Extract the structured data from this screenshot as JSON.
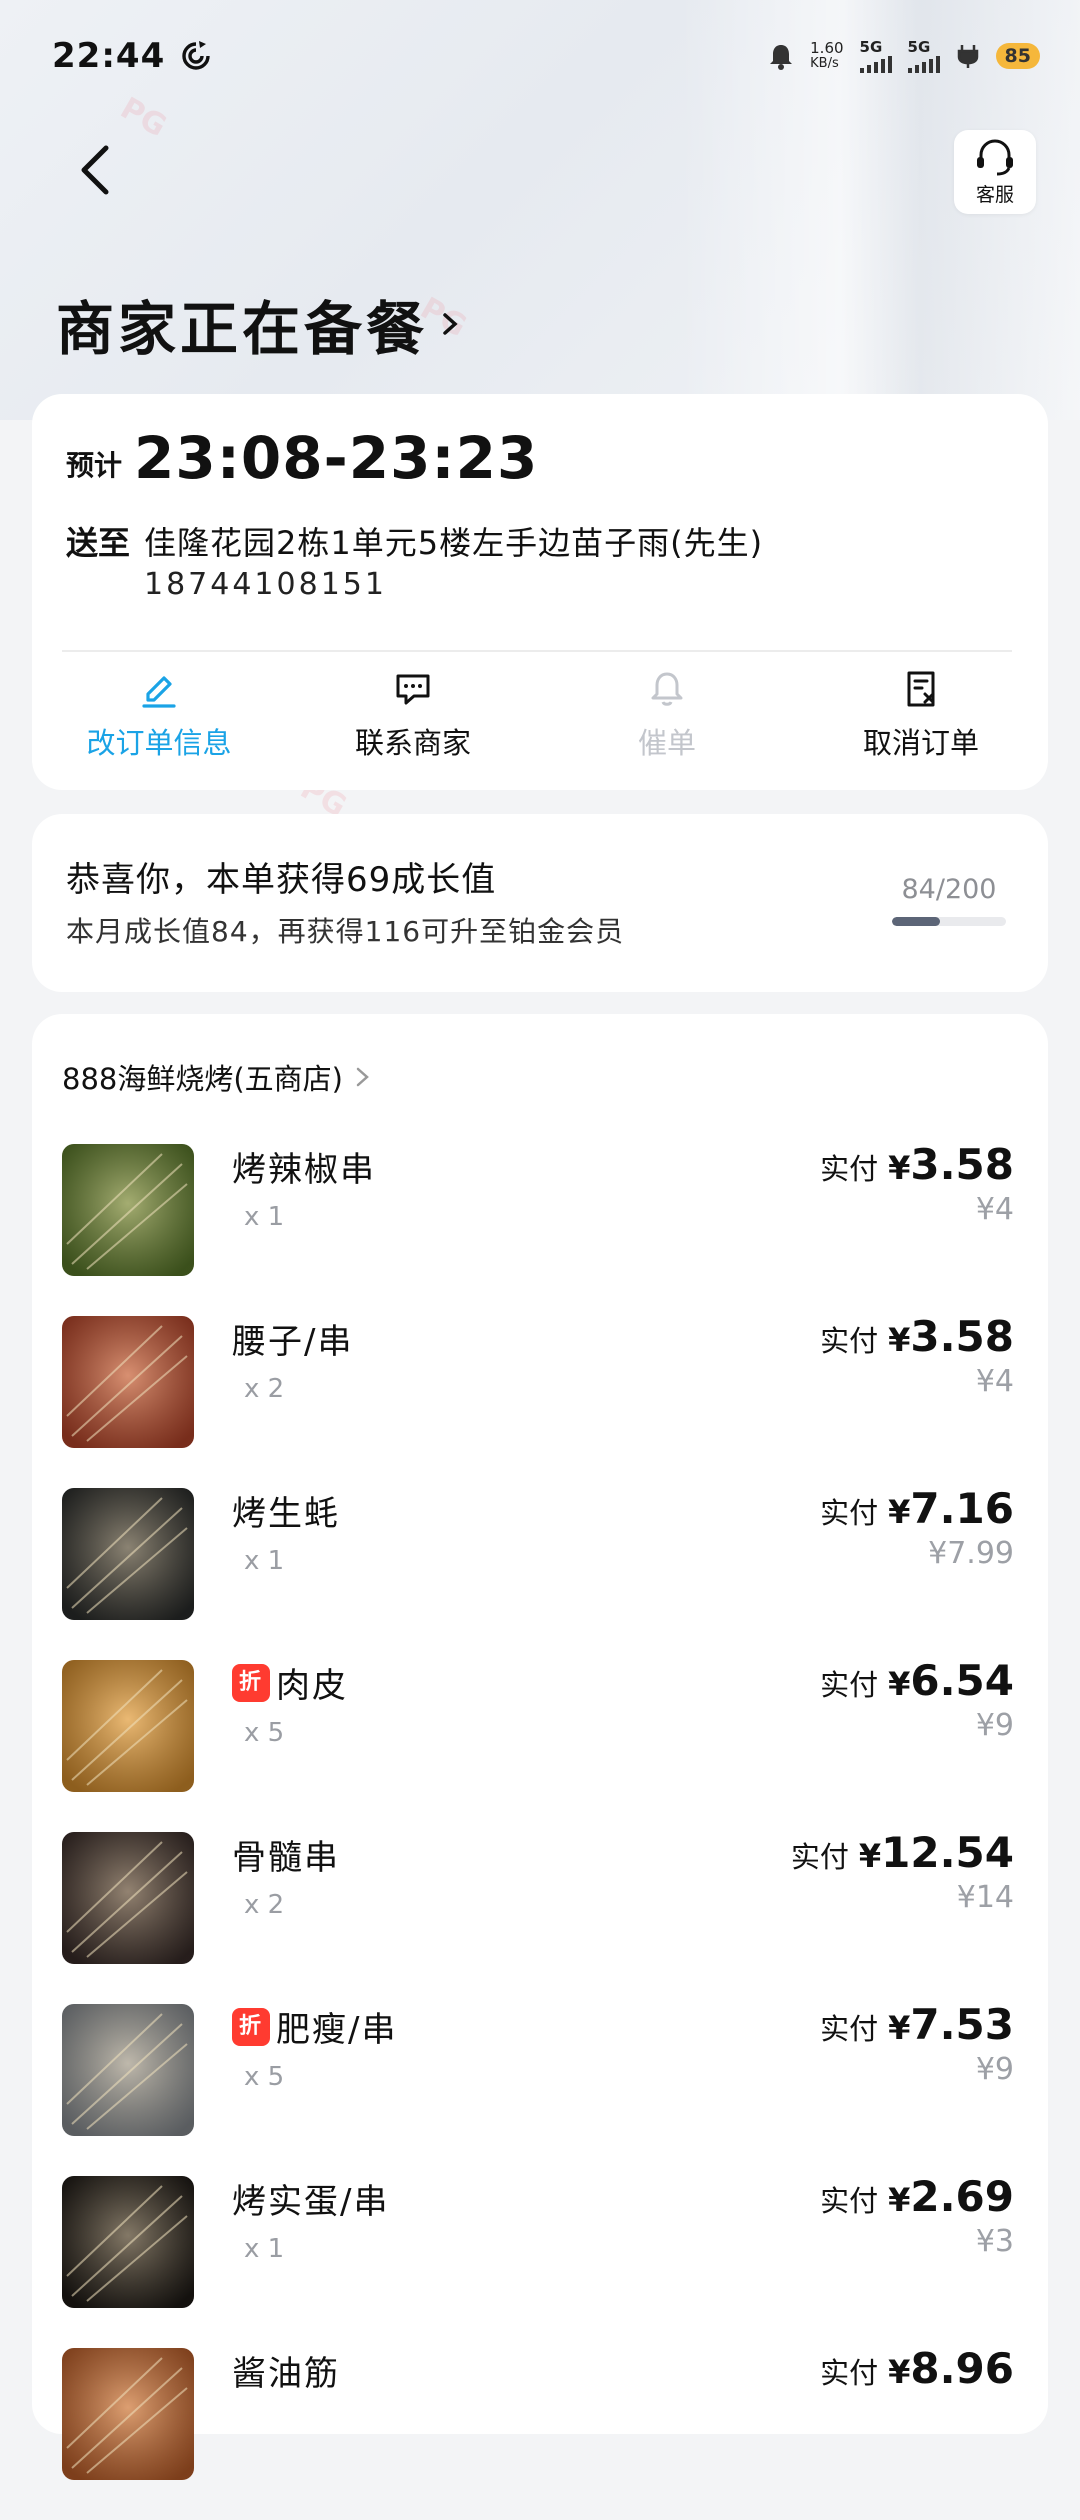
{
  "status_bar": {
    "time": "22:44",
    "net_speed": "1.60",
    "net_unit": "KB/s",
    "sim1": "5G",
    "sim2": "5G",
    "battery": "85"
  },
  "header": {
    "customer_service_label": "客服",
    "title": "商家正在备餐"
  },
  "delivery": {
    "eta_label": "预计",
    "eta_time": "23:08-23:23",
    "address_label": "送至",
    "address": "佳隆花园2栋1单元5楼左手边苗子雨(先生)",
    "phone": "18744108151"
  },
  "actions": [
    {
      "label": "改订单信息",
      "icon": "edit-icon",
      "state": "active"
    },
    {
      "label": "联系商家",
      "icon": "chat-icon",
      "state": "normal"
    },
    {
      "label": "催单",
      "icon": "bell-icon",
      "state": "disabled"
    },
    {
      "label": "取消订单",
      "icon": "cancel-doc-icon",
      "state": "normal"
    }
  ],
  "growth": {
    "headline": "恭喜你，本单获得69成长值",
    "detail": "本月成长值84，再获得116可升至铂金会员",
    "progress_text": "84/200",
    "progress_fraction": 0.42
  },
  "shop": {
    "name": "888海鲜烧烤(五商店)"
  },
  "items": [
    {
      "name": "烤辣椒串",
      "qty": "x 1",
      "paid_label": "实付",
      "currency": "¥",
      "price": "3.58",
      "original": "¥4",
      "discount_tag": "",
      "color": "#5a7a2a"
    },
    {
      "name": "腰子/串",
      "qty": "x 2",
      "paid_label": "实付",
      "currency": "¥",
      "price": "3.58",
      "original": "¥4",
      "discount_tag": "",
      "color": "#b8452a"
    },
    {
      "name": "烤生蚝",
      "qty": "x 1",
      "paid_label": "实付",
      "currency": "¥",
      "price": "7.16",
      "original": "¥7.99",
      "discount_tag": "",
      "color": "#2b2d2c"
    },
    {
      "name": "肉皮",
      "qty": "x 5",
      "paid_label": "实付",
      "currency": "¥",
      "price": "6.54",
      "original": "¥9",
      "discount_tag": "折",
      "color": "#d9902e"
    },
    {
      "name": "骨髓串",
      "qty": "x 2",
      "paid_label": "实付",
      "currency": "¥",
      "price": "12.54",
      "original": "¥14",
      "discount_tag": "",
      "color": "#3a2d2a"
    },
    {
      "name": "肥瘦/串",
      "qty": "x 5",
      "paid_label": "实付",
      "currency": "¥",
      "price": "7.53",
      "original": "¥9",
      "discount_tag": "折",
      "color": "#8a8f94"
    },
    {
      "name": "烤实蛋/串",
      "qty": "x 1",
      "paid_label": "实付",
      "currency": "¥",
      "price": "2.69",
      "original": "¥3",
      "discount_tag": "",
      "color": "#1e1a16"
    },
    {
      "name": "酱油筋",
      "qty": "",
      "paid_label": "实付",
      "currency": "¥",
      "price": "8.96",
      "original": "",
      "discount_tag": "",
      "color": "#c0602a"
    }
  ]
}
